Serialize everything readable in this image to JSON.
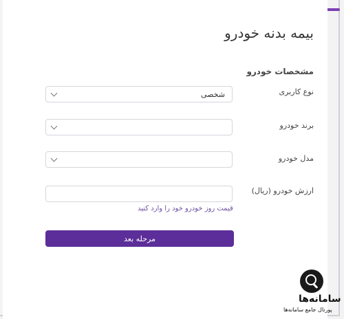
{
  "form": {
    "title": "بیمه بدنه خودرو",
    "section_title": "مشخصات خودرو",
    "fields": {
      "usage_type": {
        "label": "نوع کاربری",
        "value": "شخصی"
      },
      "brand": {
        "label": "برند خودرو",
        "value": ""
      },
      "model": {
        "label": "مدل خودرو",
        "value": ""
      },
      "value": {
        "label": "ارزش خودرو (ریال)",
        "value": "",
        "hint": "قیمت روز خودرو خود را وارد کنید"
      }
    },
    "next_button_label": "مرحله بعد"
  },
  "watermark": {
    "brand": "سامانه‌ها",
    "tagline": "پورتال جامع سامانه‌ها",
    "icon": "magnifier-icon"
  },
  "colors": {
    "accent": "#5c2e99",
    "hint": "#6c4fa0"
  }
}
